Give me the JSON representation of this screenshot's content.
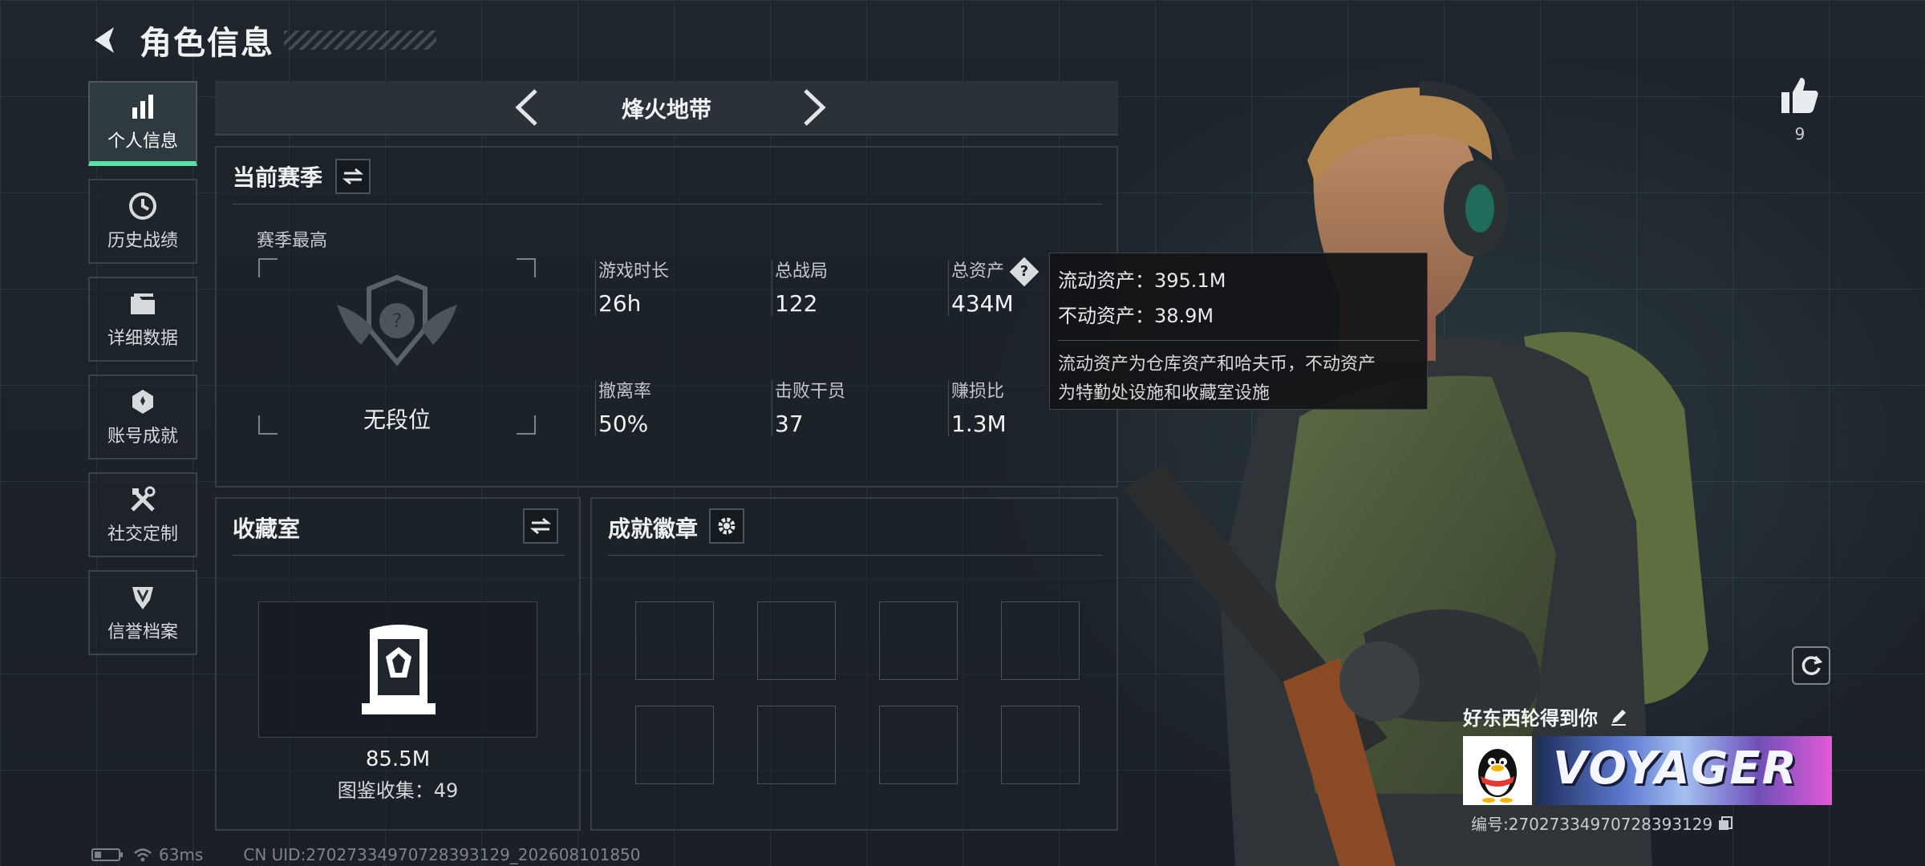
{
  "header": {
    "title": "角色信息"
  },
  "sidebar": {
    "items": [
      {
        "label": "个人信息",
        "icon": "bar-chart-icon",
        "active": true
      },
      {
        "label": "历史战绩",
        "icon": "history-clock-icon",
        "active": false
      },
      {
        "label": "详细数据",
        "icon": "folder-icon",
        "active": false
      },
      {
        "label": "账号成就",
        "icon": "achievement-icon",
        "active": false
      },
      {
        "label": "社交定制",
        "icon": "tools-icon",
        "active": false
      },
      {
        "label": "信誉档案",
        "icon": "reputation-icon",
        "active": false
      }
    ]
  },
  "mode": {
    "name": "烽火地带"
  },
  "season": {
    "title": "当前赛季",
    "best_label": "赛季最高",
    "rank_name": "无段位",
    "stats": [
      {
        "label": "游戏时长",
        "value": "26h"
      },
      {
        "label": "总战局",
        "value": "122"
      },
      {
        "label": "总资产",
        "value": "434M"
      },
      {
        "label": "撤离率",
        "value": "50%"
      },
      {
        "label": "击败干员",
        "value": "37"
      },
      {
        "label": "赚损比",
        "value": "1.3M"
      }
    ],
    "help_glyph": "?"
  },
  "tooltip": {
    "liquid": "流动资产：395.1M",
    "fixed": "不动资产：38.9M",
    "desc_line1": "流动资产为仓库资产和哈夫币，不动资产",
    "desc_line2": "为特勤处设施和收藏室设施"
  },
  "collection": {
    "title": "收藏室",
    "value": "85.5M",
    "count": "图鉴收集：49"
  },
  "badges": {
    "title": "成就徽章"
  },
  "like": {
    "count": "9"
  },
  "namecard": {
    "nickname": "好东西轮得到你",
    "banner_text": "VOYAGER",
    "uid": "编号:27027334970728393129"
  },
  "footer": {
    "ping": "63ms",
    "cn_uid": "CN UID:27027334970728393129_202608101850"
  },
  "colors": {
    "accent": "#5be0a8",
    "panel_border": "#353e46",
    "background": "#1b2128"
  }
}
